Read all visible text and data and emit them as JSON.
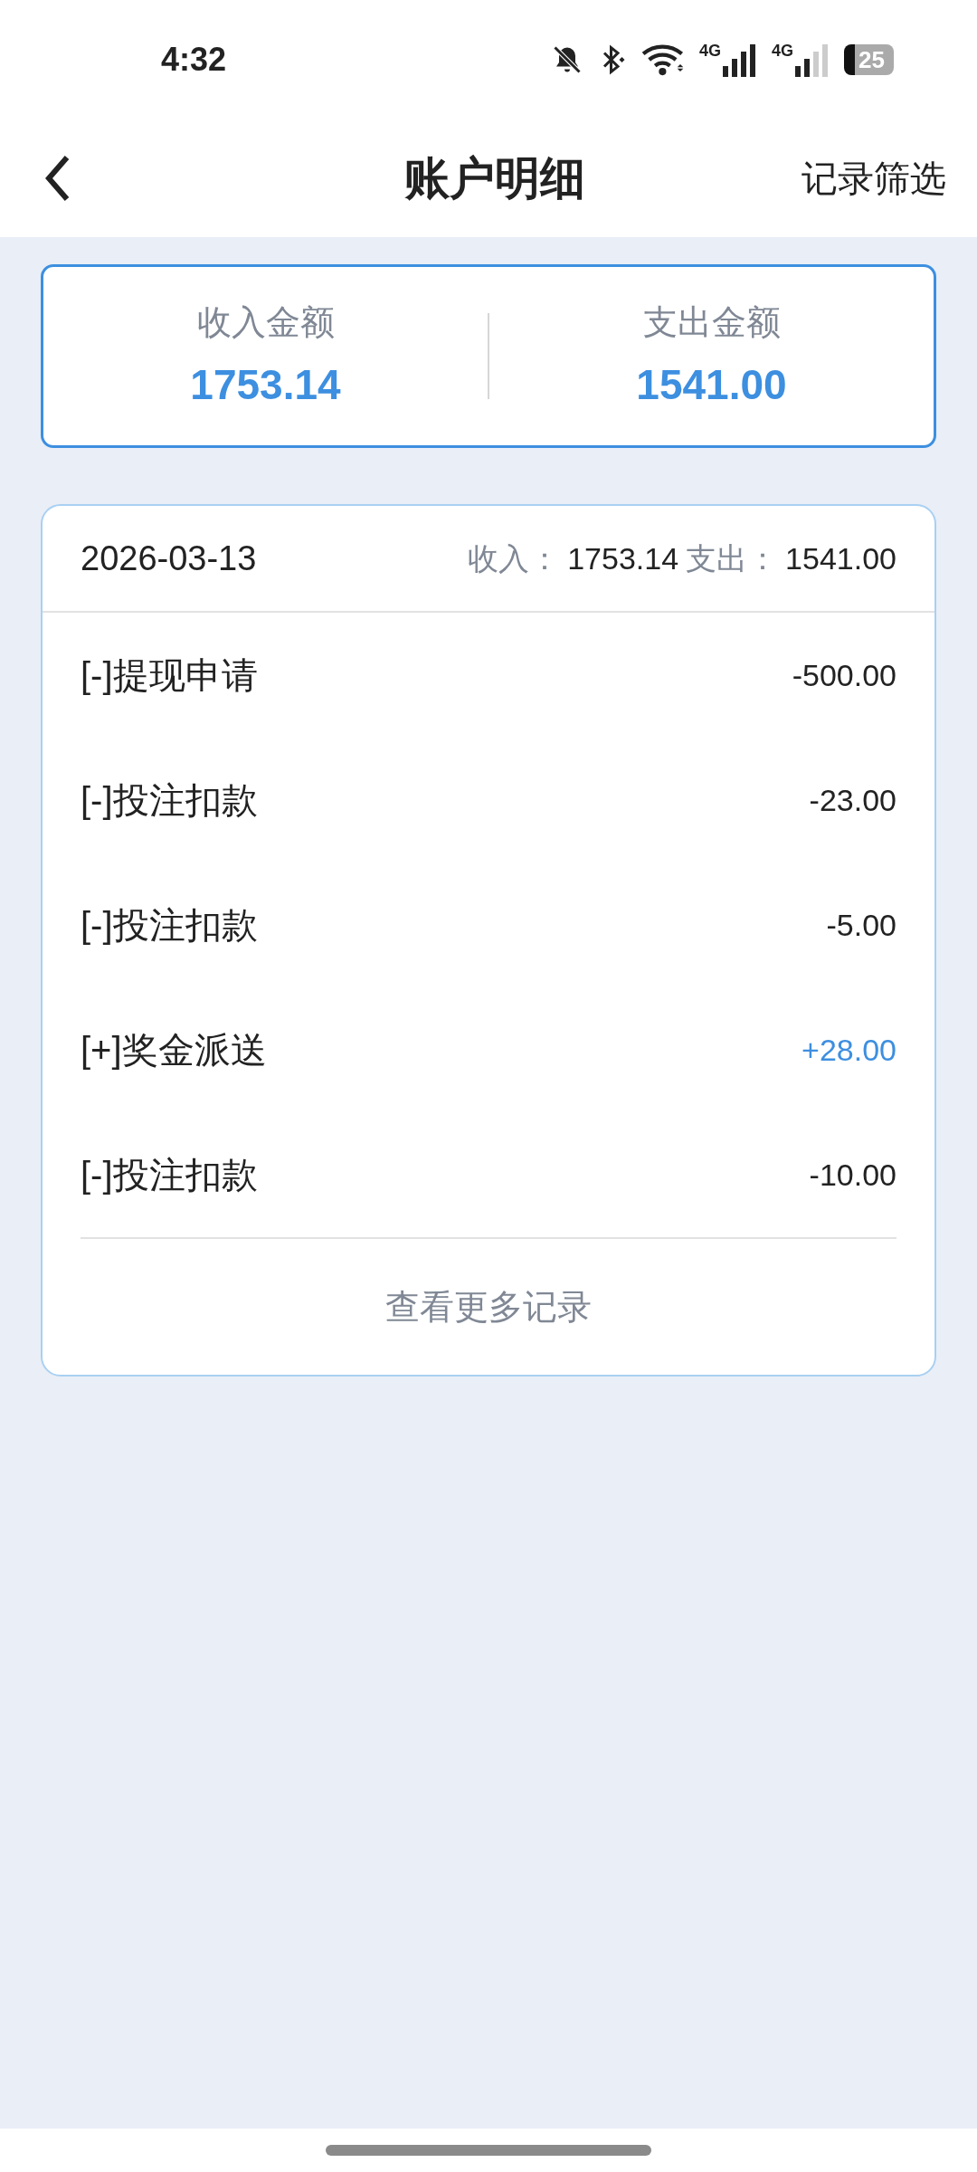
{
  "status_bar": {
    "time": "4:32",
    "battery": "25",
    "networks": [
      "4G",
      "4G"
    ]
  },
  "header": {
    "title": "账户明细",
    "action": "记录筛选"
  },
  "summary": [
    {
      "label": "收入金额",
      "value": "1753.14"
    },
    {
      "label": "支出金额",
      "value": "1541.00"
    }
  ],
  "day": {
    "date": "2026-03-13",
    "income_label": "收入：",
    "income": "1753.14",
    "expense_label": "支出：",
    "expense": "1541.00",
    "records": [
      {
        "title": "[-]提现申请",
        "amount": "-500.00",
        "kind": "expense"
      },
      {
        "title": "[-]投注扣款",
        "amount": "-23.00",
        "kind": "expense"
      },
      {
        "title": "[-]投注扣款",
        "amount": "-5.00",
        "kind": "expense"
      },
      {
        "title": "[+]奖金派送",
        "amount": "+28.00",
        "kind": "income"
      },
      {
        "title": "[-]投注扣款",
        "amount": "-10.00",
        "kind": "expense"
      }
    ],
    "more": "查看更多记录"
  }
}
